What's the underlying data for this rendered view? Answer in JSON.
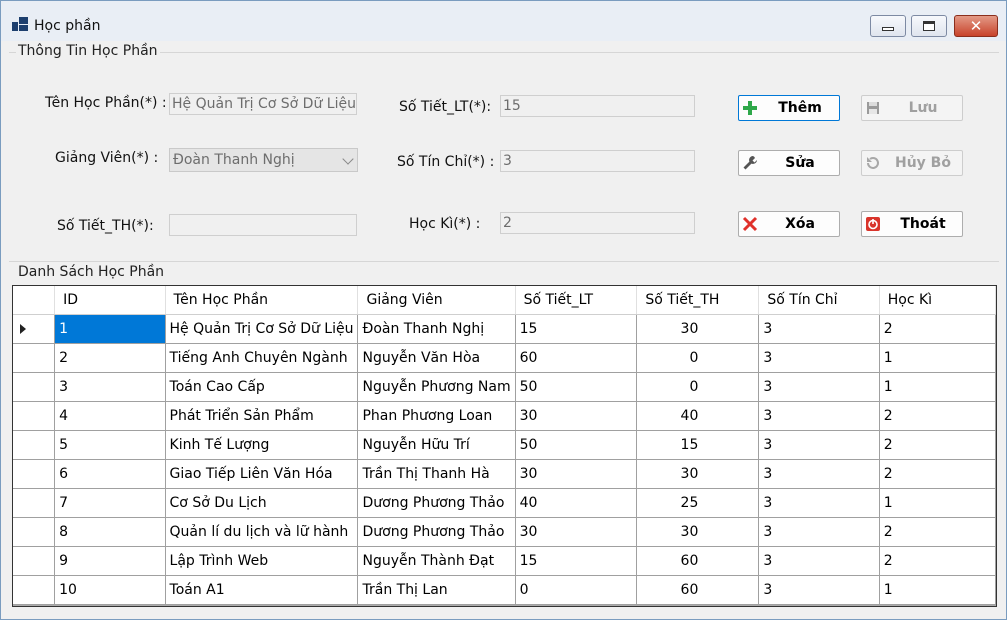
{
  "window": {
    "title": "Học phần",
    "controls": {
      "minimize": "minimize-icon",
      "maximize": "maximize-icon",
      "close": "✕"
    }
  },
  "info_group": {
    "title": "Thông Tin Học Phần",
    "fields": {
      "ten_hoc_phan": {
        "label": "Tên Học Phần(*) :",
        "value": "Hệ Quản Trị Cơ Sở Dữ Liệu"
      },
      "giang_vien": {
        "label": "Giảng Viên(*) :",
        "value": "Đoàn Thanh Nghị"
      },
      "so_tiet_th": {
        "label": "Số Tiết_TH(*):",
        "value": ""
      },
      "so_tiet_lt": {
        "label": "Số Tiết_LT(*):",
        "value": "15"
      },
      "so_tin_chi": {
        "label": "Số Tín Chỉ(*) :",
        "value": "3"
      },
      "hoc_ki": {
        "label": "Học Kì(*) :",
        "value": "2"
      }
    },
    "buttons": {
      "them": {
        "label": "Thêm",
        "icon": "plus-icon",
        "color": "#2fa84a"
      },
      "luu": {
        "label": "Lưu",
        "icon": "floppy-disk-icon"
      },
      "sua": {
        "label": "Sửa",
        "icon": "wrench-icon"
      },
      "huy_bo": {
        "label": "Hủy Bỏ",
        "icon": "undo-icon"
      },
      "xoa": {
        "label": "Xóa",
        "icon": "delete-x-icon",
        "color": "#e0302a"
      },
      "thoat": {
        "label": "Thoát",
        "icon": "power-icon",
        "color": "#d9342b"
      }
    }
  },
  "list_group": {
    "title": "Danh Sách Học Phần",
    "columns": [
      "ID",
      "Tên Học Phần",
      "Giảng Viên",
      "Số Tiết_LT",
      "Số Tiết_TH",
      "Số Tín Chỉ",
      "Học Kì"
    ],
    "rows": [
      [
        "1",
        "Hệ Quản Trị Cơ Sở Dữ Liệu",
        "Đoàn Thanh Nghị",
        "15",
        "30",
        "3",
        "2"
      ],
      [
        "2",
        "Tiếng Anh Chuyên Ngành",
        "Nguyễn Văn Hòa",
        "60",
        "0",
        "3",
        "1"
      ],
      [
        "3",
        "Toán Cao Cấp",
        "Nguyễn Phương Nam",
        "50",
        "0",
        "3",
        "1"
      ],
      [
        "4",
        "Phát Triển Sản Phẩm",
        "Phan Phương Loan",
        "30",
        "40",
        "3",
        "2"
      ],
      [
        "5",
        "Kinh Tế Lượng",
        "Nguyễn Hữu Trí",
        "50",
        "15",
        "3",
        "2"
      ],
      [
        "6",
        "Giao Tiếp Liên Văn Hóa",
        "Trần Thị Thanh Hà",
        "30",
        "30",
        "3",
        "2"
      ],
      [
        "7",
        "Cơ Sở Du Lịch",
        "Dương Phương Thảo",
        "40",
        "25",
        "3",
        "1"
      ],
      [
        "8",
        "Quản lí du lịch và lữ hành",
        "Dương Phương Thảo",
        "30",
        "30",
        "3",
        "2"
      ],
      [
        "9",
        "Lập Trình Web",
        "Nguyễn Thành Đạt",
        "15",
        "60",
        "3",
        "2"
      ],
      [
        "10",
        "Toán A1",
        "Trần Thị Lan",
        "0",
        "60",
        "3",
        "1"
      ]
    ],
    "selected_row": 0,
    "accent": "#0078d7"
  }
}
